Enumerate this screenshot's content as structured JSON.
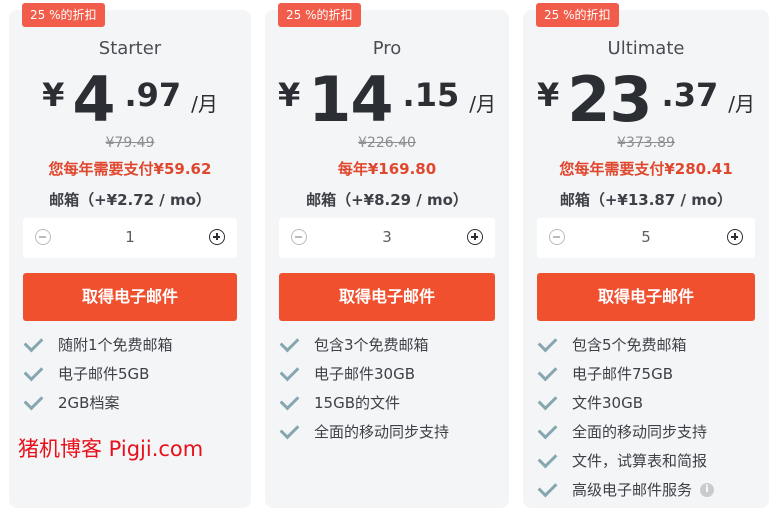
{
  "plans": [
    {
      "badge": "25 %的折扣",
      "name": "Starter",
      "currency": "¥",
      "price_int": "4",
      "price_dec": ".97",
      "per": "/月",
      "original": "¥79.49",
      "yearly": "您每年需要支付¥59.62",
      "mailbox": "邮箱（+¥2.72 / mo）",
      "quantity": "1",
      "cta": "取得电子邮件",
      "features": [
        "随附1个免费邮箱",
        "电子邮件5GB",
        "2GB档案"
      ]
    },
    {
      "badge": "25 %的折扣",
      "name": "Pro",
      "currency": "¥",
      "price_int": "14",
      "price_dec": ".15",
      "per": "/月",
      "original": "¥226.40",
      "yearly": "每年¥169.80",
      "mailbox": "邮箱（+¥8.29 / mo）",
      "quantity": "3",
      "cta": "取得电子邮件",
      "features": [
        "包含3个免费邮箱",
        "电子邮件30GB",
        "15GB的文件",
        "全面的移动同步支持"
      ]
    },
    {
      "badge": "25 %的折扣",
      "name": "Ultimate",
      "currency": "¥",
      "price_int": "23",
      "price_dec": ".37",
      "per": "/月",
      "original": "¥373.89",
      "yearly": "您每年需要支付¥280.41",
      "mailbox": "邮箱（+¥13.87 / mo）",
      "quantity": "5",
      "cta": "取得电子邮件",
      "features": [
        "包含5个免费邮箱",
        "电子邮件75GB",
        "文件30GB",
        "全面的移动同步支持",
        "文件，试算表和简报",
        "高级电子邮件服务"
      ]
    }
  ],
  "watermark": "猪机博客 Pigji.com",
  "icons": {
    "check": "check-icon",
    "minus": "minus-circle-icon",
    "plus": "plus-circle-icon",
    "info": "info-icon"
  },
  "colors": {
    "accent": "#f1502f",
    "badge": "#f25c4a",
    "yearly_text": "#e0472f",
    "check": "#86a7b0",
    "watermark": "#e8111b"
  }
}
